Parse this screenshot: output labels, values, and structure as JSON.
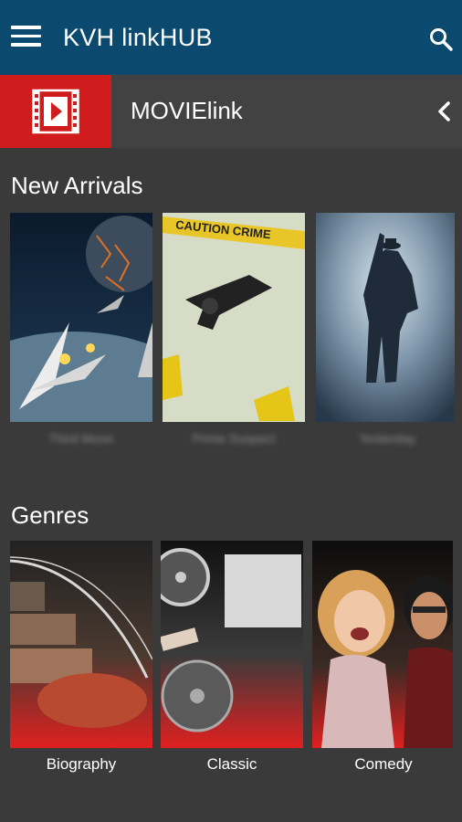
{
  "app": {
    "title": "KVH linkHUB"
  },
  "subheader": {
    "title": "MOVIElink"
  },
  "new_arrivals": {
    "heading": "New Arrivals",
    "items": [
      {
        "title": "Third Moon"
      },
      {
        "title": "Prime Suspect",
        "banner": "CAUTION CRIME"
      },
      {
        "title": "Yesterday"
      }
    ]
  },
  "genres": {
    "heading": "Genres",
    "items": [
      {
        "label": "Biography"
      },
      {
        "label": "Classic"
      },
      {
        "label": "Comedy"
      }
    ]
  },
  "icons": {
    "menu": "hamburger-menu-icon",
    "search": "search-icon",
    "logo": "film-play-icon",
    "back": "chevron-left-icon"
  },
  "colors": {
    "appbar": "#0b4a6e",
    "accent": "#d01c1c",
    "background": "#3a3a3a"
  }
}
